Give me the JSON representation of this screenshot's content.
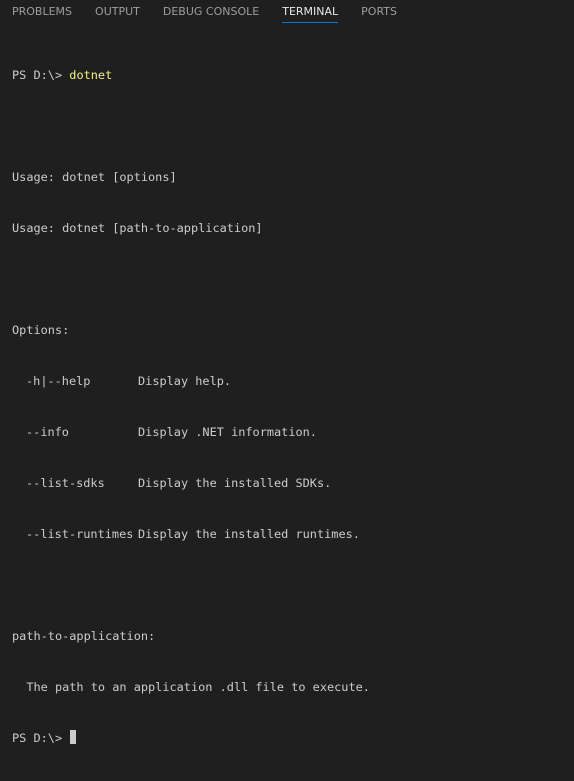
{
  "tabs": [
    {
      "label": "PROBLEMS",
      "active": false
    },
    {
      "label": "OUTPUT",
      "active": false
    },
    {
      "label": "DEBUG CONSOLE",
      "active": false
    },
    {
      "label": "TERMINAL",
      "active": true
    },
    {
      "label": "PORTS",
      "active": false
    }
  ],
  "terminal": {
    "prompt": "PS D:\\> ",
    "command": "dotnet",
    "usage1": "Usage: dotnet [options]",
    "usage2": "Usage: dotnet [path-to-application]",
    "options_header": "Options:",
    "options": [
      {
        "flag": "-h|--help",
        "desc": "Display help."
      },
      {
        "flag": "--info",
        "desc": "Display .NET information."
      },
      {
        "flag": "--list-sdks",
        "desc": "Display the installed SDKs."
      },
      {
        "flag": "--list-runtimes",
        "desc": "Display the installed runtimes."
      }
    ],
    "path_header": "path-to-application:",
    "path_desc": "  The path to an application .dll file to execute.",
    "final_prompt": "PS D:\\> "
  },
  "colors": {
    "background": "#1f1f1f",
    "text": "#cccccc",
    "command": "#f1f08e",
    "active_tab_underline": "#0078d4"
  }
}
